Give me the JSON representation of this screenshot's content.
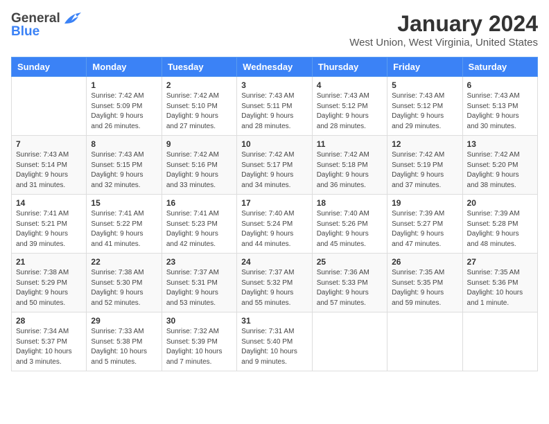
{
  "header": {
    "logo_general": "General",
    "logo_blue": "Blue",
    "title": "January 2024",
    "location": "West Union, West Virginia, United States"
  },
  "days_of_week": [
    "Sunday",
    "Monday",
    "Tuesday",
    "Wednesday",
    "Thursday",
    "Friday",
    "Saturday"
  ],
  "weeks": [
    [
      {
        "day": "",
        "info": ""
      },
      {
        "day": "1",
        "info": "Sunrise: 7:42 AM\nSunset: 5:09 PM\nDaylight: 9 hours\nand 26 minutes."
      },
      {
        "day": "2",
        "info": "Sunrise: 7:42 AM\nSunset: 5:10 PM\nDaylight: 9 hours\nand 27 minutes."
      },
      {
        "day": "3",
        "info": "Sunrise: 7:43 AM\nSunset: 5:11 PM\nDaylight: 9 hours\nand 28 minutes."
      },
      {
        "day": "4",
        "info": "Sunrise: 7:43 AM\nSunset: 5:12 PM\nDaylight: 9 hours\nand 28 minutes."
      },
      {
        "day": "5",
        "info": "Sunrise: 7:43 AM\nSunset: 5:12 PM\nDaylight: 9 hours\nand 29 minutes."
      },
      {
        "day": "6",
        "info": "Sunrise: 7:43 AM\nSunset: 5:13 PM\nDaylight: 9 hours\nand 30 minutes."
      }
    ],
    [
      {
        "day": "7",
        "info": "Sunrise: 7:43 AM\nSunset: 5:14 PM\nDaylight: 9 hours\nand 31 minutes."
      },
      {
        "day": "8",
        "info": "Sunrise: 7:43 AM\nSunset: 5:15 PM\nDaylight: 9 hours\nand 32 minutes."
      },
      {
        "day": "9",
        "info": "Sunrise: 7:42 AM\nSunset: 5:16 PM\nDaylight: 9 hours\nand 33 minutes."
      },
      {
        "day": "10",
        "info": "Sunrise: 7:42 AM\nSunset: 5:17 PM\nDaylight: 9 hours\nand 34 minutes."
      },
      {
        "day": "11",
        "info": "Sunrise: 7:42 AM\nSunset: 5:18 PM\nDaylight: 9 hours\nand 36 minutes."
      },
      {
        "day": "12",
        "info": "Sunrise: 7:42 AM\nSunset: 5:19 PM\nDaylight: 9 hours\nand 37 minutes."
      },
      {
        "day": "13",
        "info": "Sunrise: 7:42 AM\nSunset: 5:20 PM\nDaylight: 9 hours\nand 38 minutes."
      }
    ],
    [
      {
        "day": "14",
        "info": "Sunrise: 7:41 AM\nSunset: 5:21 PM\nDaylight: 9 hours\nand 39 minutes."
      },
      {
        "day": "15",
        "info": "Sunrise: 7:41 AM\nSunset: 5:22 PM\nDaylight: 9 hours\nand 41 minutes."
      },
      {
        "day": "16",
        "info": "Sunrise: 7:41 AM\nSunset: 5:23 PM\nDaylight: 9 hours\nand 42 minutes."
      },
      {
        "day": "17",
        "info": "Sunrise: 7:40 AM\nSunset: 5:24 PM\nDaylight: 9 hours\nand 44 minutes."
      },
      {
        "day": "18",
        "info": "Sunrise: 7:40 AM\nSunset: 5:26 PM\nDaylight: 9 hours\nand 45 minutes."
      },
      {
        "day": "19",
        "info": "Sunrise: 7:39 AM\nSunset: 5:27 PM\nDaylight: 9 hours\nand 47 minutes."
      },
      {
        "day": "20",
        "info": "Sunrise: 7:39 AM\nSunset: 5:28 PM\nDaylight: 9 hours\nand 48 minutes."
      }
    ],
    [
      {
        "day": "21",
        "info": "Sunrise: 7:38 AM\nSunset: 5:29 PM\nDaylight: 9 hours\nand 50 minutes."
      },
      {
        "day": "22",
        "info": "Sunrise: 7:38 AM\nSunset: 5:30 PM\nDaylight: 9 hours\nand 52 minutes."
      },
      {
        "day": "23",
        "info": "Sunrise: 7:37 AM\nSunset: 5:31 PM\nDaylight: 9 hours\nand 53 minutes."
      },
      {
        "day": "24",
        "info": "Sunrise: 7:37 AM\nSunset: 5:32 PM\nDaylight: 9 hours\nand 55 minutes."
      },
      {
        "day": "25",
        "info": "Sunrise: 7:36 AM\nSunset: 5:33 PM\nDaylight: 9 hours\nand 57 minutes."
      },
      {
        "day": "26",
        "info": "Sunrise: 7:35 AM\nSunset: 5:35 PM\nDaylight: 9 hours\nand 59 minutes."
      },
      {
        "day": "27",
        "info": "Sunrise: 7:35 AM\nSunset: 5:36 PM\nDaylight: 10 hours\nand 1 minute."
      }
    ],
    [
      {
        "day": "28",
        "info": "Sunrise: 7:34 AM\nSunset: 5:37 PM\nDaylight: 10 hours\nand 3 minutes."
      },
      {
        "day": "29",
        "info": "Sunrise: 7:33 AM\nSunset: 5:38 PM\nDaylight: 10 hours\nand 5 minutes."
      },
      {
        "day": "30",
        "info": "Sunrise: 7:32 AM\nSunset: 5:39 PM\nDaylight: 10 hours\nand 7 minutes."
      },
      {
        "day": "31",
        "info": "Sunrise: 7:31 AM\nSunset: 5:40 PM\nDaylight: 10 hours\nand 9 minutes."
      },
      {
        "day": "",
        "info": ""
      },
      {
        "day": "",
        "info": ""
      },
      {
        "day": "",
        "info": ""
      }
    ]
  ]
}
